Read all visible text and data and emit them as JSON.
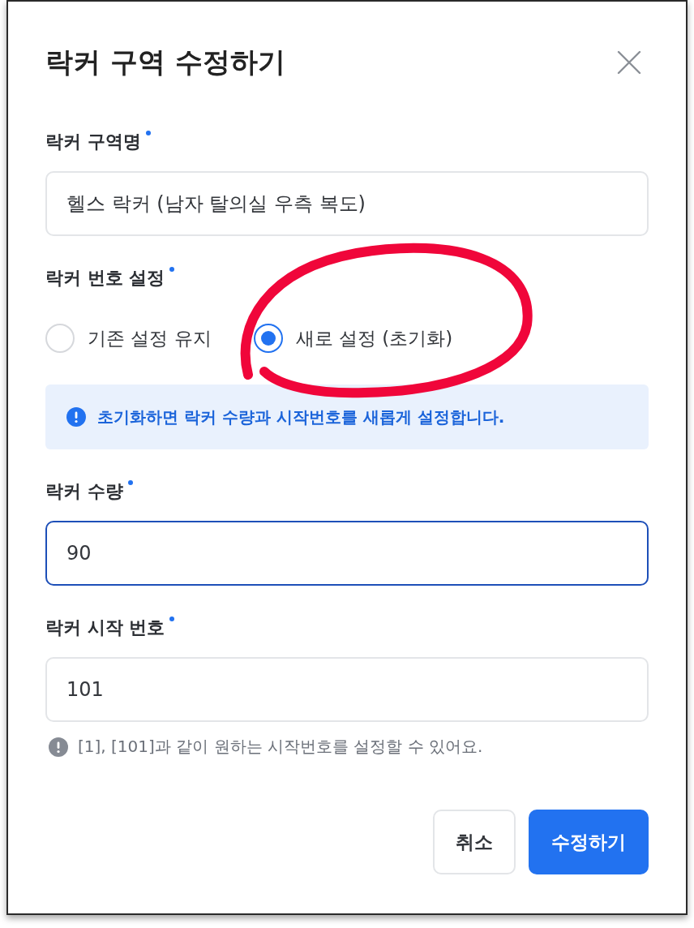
{
  "dialog": {
    "title": "락커 구역 수정하기"
  },
  "fields": [
    {
      "kind": "input",
      "label": "락커 구역명",
      "required": true,
      "value": "헬스 락커 (남자 탈의실 우측 복도)",
      "focused": false
    },
    {
      "kind": "radio",
      "label": "락커 번호 설정",
      "required": true,
      "options": [
        {
          "label": "기존 설정 유지",
          "selected": false
        },
        {
          "label": "새로 설정 (초기화)",
          "selected": true
        }
      ],
      "notice": "초기화하면 락커 수량과 시작번호를 새롭게 설정합니다."
    },
    {
      "kind": "input",
      "label": "락커 수량",
      "required": true,
      "value": "90",
      "focused": true
    },
    {
      "kind": "input",
      "label": "락커 시작 번호",
      "required": true,
      "value": "101",
      "focused": false,
      "hint": "[1], [101]과 같이 원하는 시작번호를 설정할 수 있어요."
    }
  ],
  "buttons": [
    {
      "label": "취소",
      "kind": "secondary"
    },
    {
      "label": "수정하기",
      "kind": "primary"
    }
  ],
  "annotation": {
    "kind": "circle"
  }
}
